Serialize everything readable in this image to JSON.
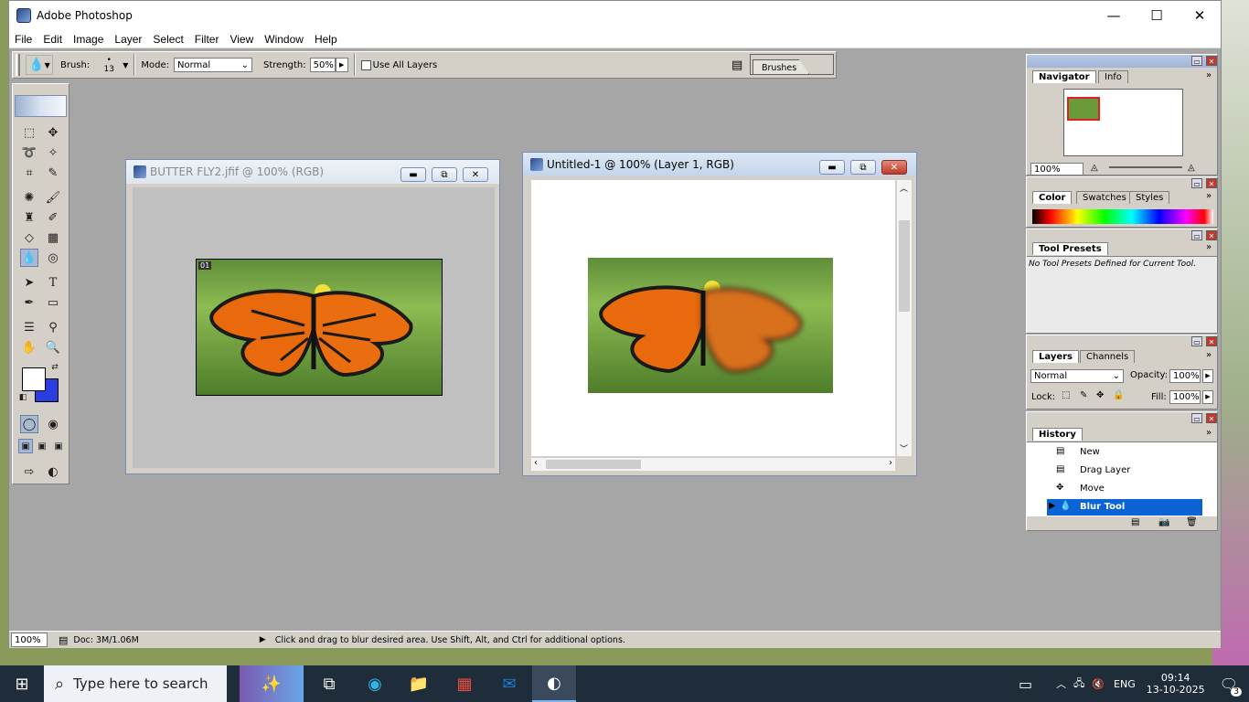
{
  "app": {
    "title": "Adobe Photoshop",
    "window_controls": {
      "minimize": "—",
      "maximize": "☐",
      "close": "✕"
    }
  },
  "menu": [
    "File",
    "Edit",
    "Image",
    "Layer",
    "Select",
    "Filter",
    "View",
    "Window",
    "Help"
  ],
  "options_bar": {
    "brush_label": "Brush:",
    "brush_size": "13",
    "mode_label": "Mode:",
    "mode_value": "Normal",
    "strength_label": "Strength:",
    "strength_value": "50%",
    "use_all_layers": "Use All Layers",
    "brushes_tab": "Brushes"
  },
  "doc1": {
    "title": "BUTTER FLY2.jfif @ 100% (RGB)",
    "badge": "01",
    "state": "inactive"
  },
  "doc2": {
    "title": "Untitled-1 @ 100% (Layer 1, RGB)",
    "state": "active"
  },
  "navigator": {
    "tabs": [
      "Navigator",
      "Info"
    ],
    "zoom": "100%"
  },
  "color_panel": {
    "tabs": [
      "Color",
      "Swatches",
      "Styles"
    ]
  },
  "tool_presets": {
    "tab": "Tool Presets",
    "message": "No Tool Presets Defined for Current Tool."
  },
  "layers": {
    "tabs": [
      "Layers",
      "Channels"
    ],
    "blend_mode": "Normal",
    "opacity_label": "Opacity:",
    "opacity_value": "100%",
    "lock_label": "Lock:",
    "fill_label": "Fill:",
    "fill_value": "100%"
  },
  "history": {
    "tab": "History",
    "items": [
      "New",
      "Drag Layer",
      "Move",
      "Blur Tool"
    ],
    "selected": "Blur Tool"
  },
  "status": {
    "zoom": "100%",
    "doc": "Doc: 3M/1.06M",
    "hint": "Click and drag to blur desired area.  Use Shift, Alt, and Ctrl for additional options."
  },
  "taskbar": {
    "search_placeholder": "Type here to search",
    "lang": "ENG",
    "time": "09:14",
    "date": "13-10-2025",
    "notifications": "3"
  },
  "colors": {
    "foreground": "#ffffff",
    "background": "#2a3ee0",
    "selection": "#0a64d6"
  }
}
